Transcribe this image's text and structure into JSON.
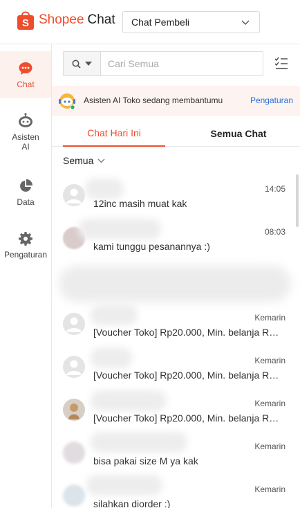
{
  "header": {
    "brand": "Shopee",
    "product": "Chat",
    "role_selected": "Chat Pembeli"
  },
  "sidebar": {
    "items": [
      {
        "label": "Chat",
        "icon": "chat-bubble-icon",
        "active": true
      },
      {
        "label": "Asisten AI",
        "icon": "robot-icon",
        "active": false
      },
      {
        "label": "Data",
        "icon": "pie-chart-icon",
        "active": false
      },
      {
        "label": "Pengaturan",
        "icon": "gear-icon",
        "active": false
      }
    ]
  },
  "search": {
    "placeholder": "Cari Semua",
    "value": ""
  },
  "ai_banner": {
    "text": "Asisten AI Toko sedang membantumu",
    "link": "Pengaturan"
  },
  "tabs": [
    {
      "label": "Chat Hari Ini",
      "active": true
    },
    {
      "label": "Semua Chat",
      "active": false
    }
  ],
  "filter": {
    "selected": "Semua"
  },
  "conversations": [
    {
      "time": "14:05",
      "preview": "12inc masih muat kak",
      "avatar": "default"
    },
    {
      "time": "08:03",
      "preview": "kami tunggu pesanannya :)",
      "avatar": "photo"
    },
    {
      "time": "Kemarin",
      "preview": "[Voucher Toko] Rp20.000, Min. belanja Rp...",
      "avatar": "default"
    },
    {
      "time": "Kemarin",
      "preview": "[Voucher Toko] Rp20.000, Min. belanja Rp...",
      "avatar": "default"
    },
    {
      "time": "Kemarin",
      "preview": "[Voucher Toko] Rp20.000, Min. belanja Rp...",
      "avatar": "photo"
    },
    {
      "time": "Kemarin",
      "preview": "bisa pakai size M ya kak",
      "avatar": "photo"
    },
    {
      "time": "Kemarin",
      "preview": "silahkan diorder :)",
      "avatar": "photo"
    }
  ],
  "colors": {
    "brand": "#ee4d2d",
    "link": "#2673dd",
    "banner_bg": "#fdf3f0"
  }
}
